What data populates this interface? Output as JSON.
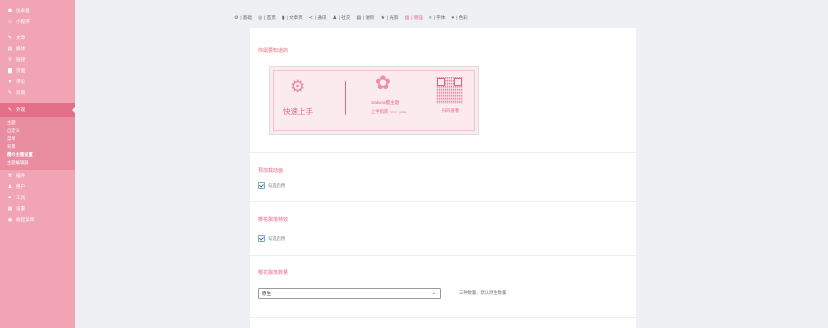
{
  "sidebar": {
    "top_items": [
      {
        "icon": "☗",
        "icon_name": "dashboard-icon",
        "label": "仪表盘"
      },
      {
        "icon": "◇",
        "icon_name": "miniprogram-icon",
        "label": "小程序"
      }
    ],
    "items": [
      {
        "icon": "✎",
        "icon_name": "pin-icon",
        "label": "文章"
      },
      {
        "icon": "▤",
        "icon_name": "media-icon",
        "label": "媒体"
      },
      {
        "icon": "⚲",
        "icon_name": "link-icon",
        "label": "链接"
      },
      {
        "icon": "▇",
        "icon_name": "page-icon",
        "label": "页面"
      },
      {
        "icon": "▼",
        "icon_name": "comment-icon",
        "label": "评论"
      },
      {
        "icon": "✎",
        "icon_name": "feedback-icon",
        "label": "反馈"
      }
    ],
    "active_item": {
      "icon": "✎",
      "icon_name": "appearance-icon",
      "label": "外观"
    },
    "submenu": [
      "主题",
      "自定义",
      "菜单",
      "背景",
      "樱の主题设置",
      "主题编辑器"
    ],
    "bottom_items": [
      {
        "icon": "⚒",
        "icon_name": "plugin-icon",
        "label": "插件"
      },
      {
        "icon": "♟",
        "icon_name": "user-icon",
        "label": "用户"
      },
      {
        "icon": "✒",
        "icon_name": "tools-icon",
        "label": "工具"
      },
      {
        "icon": "▦",
        "icon_name": "settings-icon",
        "label": "设置"
      },
      {
        "icon": "◉",
        "icon_name": "collapse-icon",
        "label": "收起菜单"
      }
    ],
    "bg_color": "#f0a4b4",
    "active_color": "#e46f89"
  },
  "tabs": [
    {
      "icon": "⚙",
      "icon_name": "gear-icon",
      "label": "| 基础"
    },
    {
      "icon": "◎",
      "icon_name": "home-icon",
      "label": "| 首页"
    },
    {
      "icon": "▮",
      "icon_name": "article-icon",
      "label": "| 文章页"
    },
    {
      "icon": "≺",
      "icon_name": "share-icon",
      "label": "| 通讯"
    },
    {
      "icon": "♟",
      "icon_name": "social-icon",
      "label": "| 社交"
    },
    {
      "icon": "▤",
      "icon_name": "advanced-icon",
      "label": "| 进阶"
    },
    {
      "icon": "★",
      "icon_name": "star-icon",
      "label": "| 光影"
    },
    {
      "icon": "▥",
      "icon_name": "grid-icon",
      "label": "| 增强",
      "active": true
    },
    {
      "icon": "≡",
      "icon_name": "font-icon",
      "label": "| 字体"
    },
    {
      "icon": "♥",
      "icon_name": "color-icon",
      "label": "| 色彩"
    }
  ],
  "accent_color": "#e9677f",
  "main": {
    "section1_title": "你需要知道的",
    "banner": {
      "start_text": "快速上手",
      "brand_text": "Sakura樱主题",
      "sub_text": "上手指南",
      "sub_small": "V3.0 · guide",
      "qr_text": "扫码查看"
    },
    "section2_title": "预加载动画",
    "section2_checkbox": "勾选启用",
    "section3_title": "樱花飘落特效",
    "section3_checkbox": "勾选启用",
    "section4_title": "樱花飘落数量",
    "select_value": "原生",
    "select_hint": "三种数量，默认原生数量"
  }
}
